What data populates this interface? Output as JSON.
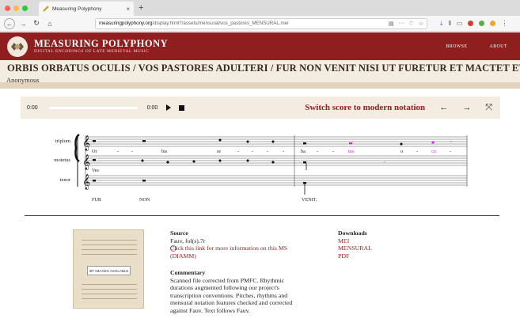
{
  "browser": {
    "tab_title": "Measuring Polyphony",
    "url_prefix": "",
    "url_domain": "measuringpolyphony.org",
    "url_path": "/display.html?/assets/mensural/vos_pastores_MENSURAL.mei"
  },
  "site": {
    "name": "MEASURING POLYPHONY",
    "tagline": "DIGITAL ENCODINGS OF LATE MEDIEVAL MUSIC",
    "nav": [
      "BROWSE",
      "ABOUT"
    ]
  },
  "piece": {
    "title": "ORBIS ORBATUS OCULIS / VOS PASTORES ADULTERI / FUR NON VENIT NISI UT FURETUR ET MACTET ET PERDAT",
    "composer": "Anonymous"
  },
  "player": {
    "time_start": "0:00",
    "time_end": "0:00",
    "progress": 0,
    "switch_label": "Switch score to modern notation"
  },
  "score": {
    "voices": [
      "triplum",
      "motetus",
      "tenor"
    ],
    "lyrics_triplum": [
      "Or",
      "-",
      "-",
      "bis",
      "or",
      "-",
      "-",
      "-",
      "-",
      "ba",
      "-",
      "-",
      "tus",
      "o",
      "-",
      "cu",
      "-"
    ],
    "lyrics_motetus": [
      "Ves"
    ],
    "lyrics_tenor": [
      "FUR",
      "NON",
      "VENIT,"
    ],
    "highlight_color": "#d12be0"
  },
  "source": {
    "heading": "Source",
    "ms": "Fauv, fol(s).7r",
    "link": "Click this link for more information on this MS (DIAMM)",
    "image_placeholder": "IIIF IMAGES AVAILABLE"
  },
  "commentary": {
    "heading": "Commentary",
    "text": "Scanned file corrected from PMFC. Rhythmic durations augmented following our project's transcription conventions. Pitches, rhythms and mensural notation features checked and corrected against Fauv. Text follows Fauv."
  },
  "downloads": {
    "heading": "Downloads",
    "items": [
      "MEI",
      "MENSURAL",
      "PDF"
    ]
  },
  "colors": {
    "brand_red": "#8f1e1f",
    "banner_beige": "#f3ece1"
  }
}
